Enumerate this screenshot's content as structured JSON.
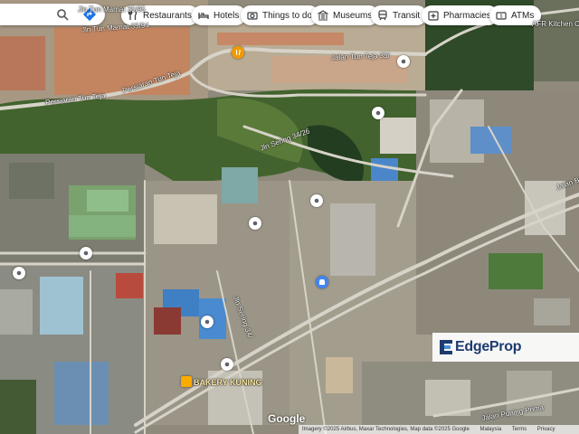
{
  "search": {
    "search_icon": "search-icon",
    "directions_icon": "directions-icon"
  },
  "categories": [
    {
      "label": "Restaurants",
      "icon": "fork-knife-icon"
    },
    {
      "label": "Hotels",
      "icon": "bed-icon"
    },
    {
      "label": "Things to do",
      "icon": "camera-icon"
    },
    {
      "label": "Museums",
      "icon": "museum-icon"
    },
    {
      "label": "Transit",
      "icon": "train-icon"
    },
    {
      "label": "Pharmacies",
      "icon": "pharmacy-icon"
    },
    {
      "label": "ATMs",
      "icon": "atm-icon"
    }
  ],
  "roads": [
    {
      "name": "Jln Tun Mamat 35/95"
    },
    {
      "name": "Jln Tun Mamat 35/94"
    },
    {
      "name": "Persiaran Tun Teja"
    },
    {
      "name": "Persiaran Tun Teja"
    },
    {
      "name": "Jalan Tun Teja 35/"
    },
    {
      "name": "Jln Sering 34/26"
    },
    {
      "name": "Jln Sering 34/"
    },
    {
      "name": "Jalan Bu"
    },
    {
      "name": "Jalan Puning Prima"
    }
  ],
  "places": [
    {
      "name": "AFR Kitchen Cabin"
    },
    {
      "name": "BAKERY KUNING"
    }
  ],
  "watermark": {
    "brand": "EdgeProp",
    "accent": "#1d3b6f"
  },
  "footer": {
    "logo": "Google",
    "imagery": "Imagery ©2025 Airbus, Maxar Technologies, Map data ©2025 Google",
    "country": "Malaysia",
    "terms": "Terms",
    "privacy": "Privacy"
  },
  "colors": {
    "chip_bg": "#ffffff",
    "directions_blue": "#1a73e8",
    "pin_blue": "#4285f4",
    "pin_orange": "#f29900"
  }
}
